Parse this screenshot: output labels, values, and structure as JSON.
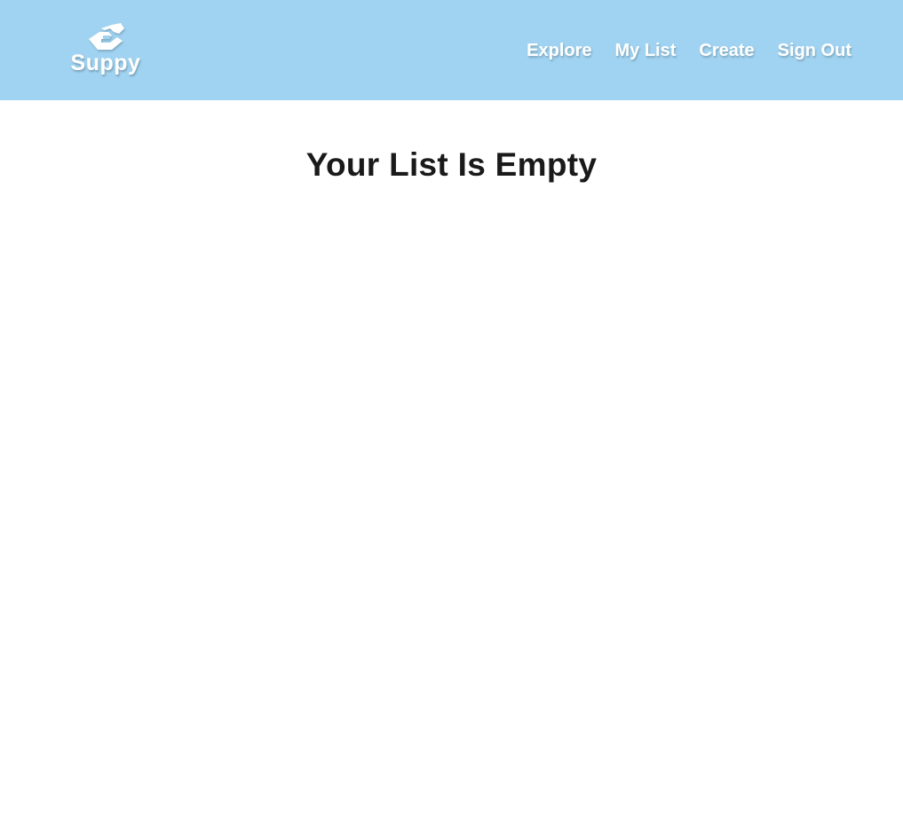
{
  "brand": {
    "name": "Suppy",
    "icon": "handshake-icon"
  },
  "nav": {
    "items": [
      {
        "label": "Explore"
      },
      {
        "label": "My List"
      },
      {
        "label": "Create"
      },
      {
        "label": "Sign Out"
      }
    ]
  },
  "main": {
    "title": "Your List Is Empty"
  },
  "colors": {
    "header_bg": "#a0d3f1",
    "header_text": "#ffffff",
    "title_text": "#1a1a1a"
  }
}
